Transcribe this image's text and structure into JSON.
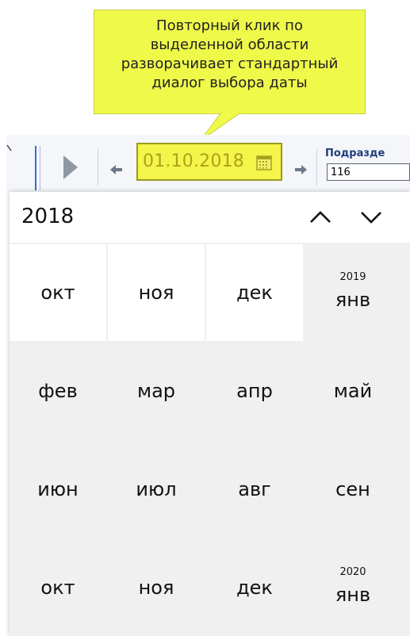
{
  "callout": {
    "lines": [
      "Повторный клик по",
      "выделенной области",
      "разворачивает стандартный",
      "диалог выбора даты"
    ]
  },
  "toolbar": {
    "date_value": "01.10.2018",
    "subdivision_label": "Подразде",
    "subdivision_value": "116",
    "colors": {
      "highlight": "#f5f44a",
      "highlight_border": "#9a9a1e",
      "date_text": "#a9a31b",
      "accent_line": "#2e6fd8"
    }
  },
  "calendar": {
    "year": "2018",
    "nav_up_icon": "chevron-up-icon",
    "nav_down_icon": "chevron-down-icon",
    "rows": [
      [
        {
          "month": "окт",
          "year": ""
        },
        {
          "month": "ноя",
          "year": ""
        },
        {
          "month": "дек",
          "year": ""
        },
        {
          "month": "янв",
          "year": "2019"
        }
      ],
      [
        {
          "month": "фев",
          "year": ""
        },
        {
          "month": "мар",
          "year": ""
        },
        {
          "month": "апр",
          "year": ""
        },
        {
          "month": "май",
          "year": ""
        }
      ],
      [
        {
          "month": "июн",
          "year": ""
        },
        {
          "month": "июл",
          "year": ""
        },
        {
          "month": "авг",
          "year": ""
        },
        {
          "month": "сен",
          "year": ""
        }
      ],
      [
        {
          "month": "окт",
          "year": ""
        },
        {
          "month": "ноя",
          "year": ""
        },
        {
          "month": "дек",
          "year": ""
        },
        {
          "month": "янв",
          "year": "2020"
        }
      ]
    ],
    "current_year_months_in_first_row": 3
  }
}
